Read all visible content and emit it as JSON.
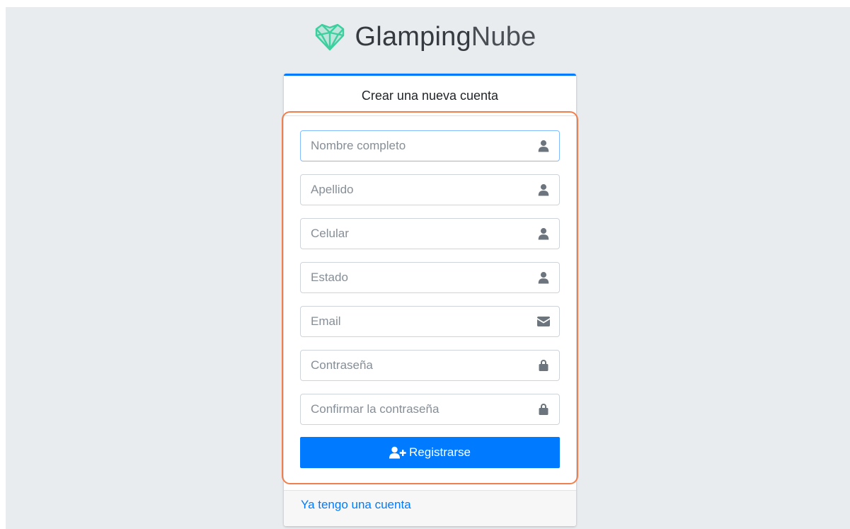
{
  "brand": {
    "name_bold": "Glamping",
    "name_light": "Nube",
    "logo_icon": "heart-gem-icon",
    "logo_color": "#3ecf9f"
  },
  "card": {
    "title": "Crear una nueva cuenta",
    "accent": "#007bff"
  },
  "form": {
    "fields": [
      {
        "placeholder": "Nombre completo",
        "icon": "user-icon",
        "value": ""
      },
      {
        "placeholder": "Apellido",
        "icon": "user-icon",
        "value": ""
      },
      {
        "placeholder": "Celular",
        "icon": "user-icon",
        "value": ""
      },
      {
        "placeholder": "Estado",
        "icon": "user-icon",
        "value": ""
      },
      {
        "placeholder": "Email",
        "icon": "envelope-icon",
        "value": ""
      },
      {
        "placeholder": "Contraseña",
        "icon": "lock-icon",
        "value": ""
      },
      {
        "placeholder": "Confirmar la contraseña",
        "icon": "lock-icon",
        "value": ""
      }
    ],
    "submit_label": "Registrarse",
    "submit_icon": "user-plus-icon"
  },
  "footer": {
    "login_link": "Ya tengo una cuenta"
  },
  "highlight_color": "#f07f4f"
}
